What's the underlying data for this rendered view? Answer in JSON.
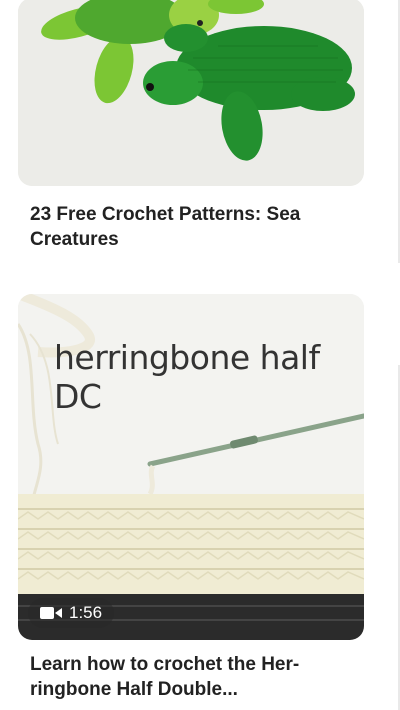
{
  "pins": [
    {
      "title": "23 Free Crochet Patterns: Sea Creatures",
      "image_alt": "crochet turtles"
    },
    {
      "title": "Learn how to crochet the Her-ringbone Half Double...",
      "overlay_text": "herringbone half DC",
      "video_duration": "1:56"
    }
  ],
  "colors": {
    "turtle_dark": "#1f8a2c",
    "turtle_light": "#7cc634",
    "yarn": "#f0ecd3",
    "hook": "#8aa38a"
  }
}
